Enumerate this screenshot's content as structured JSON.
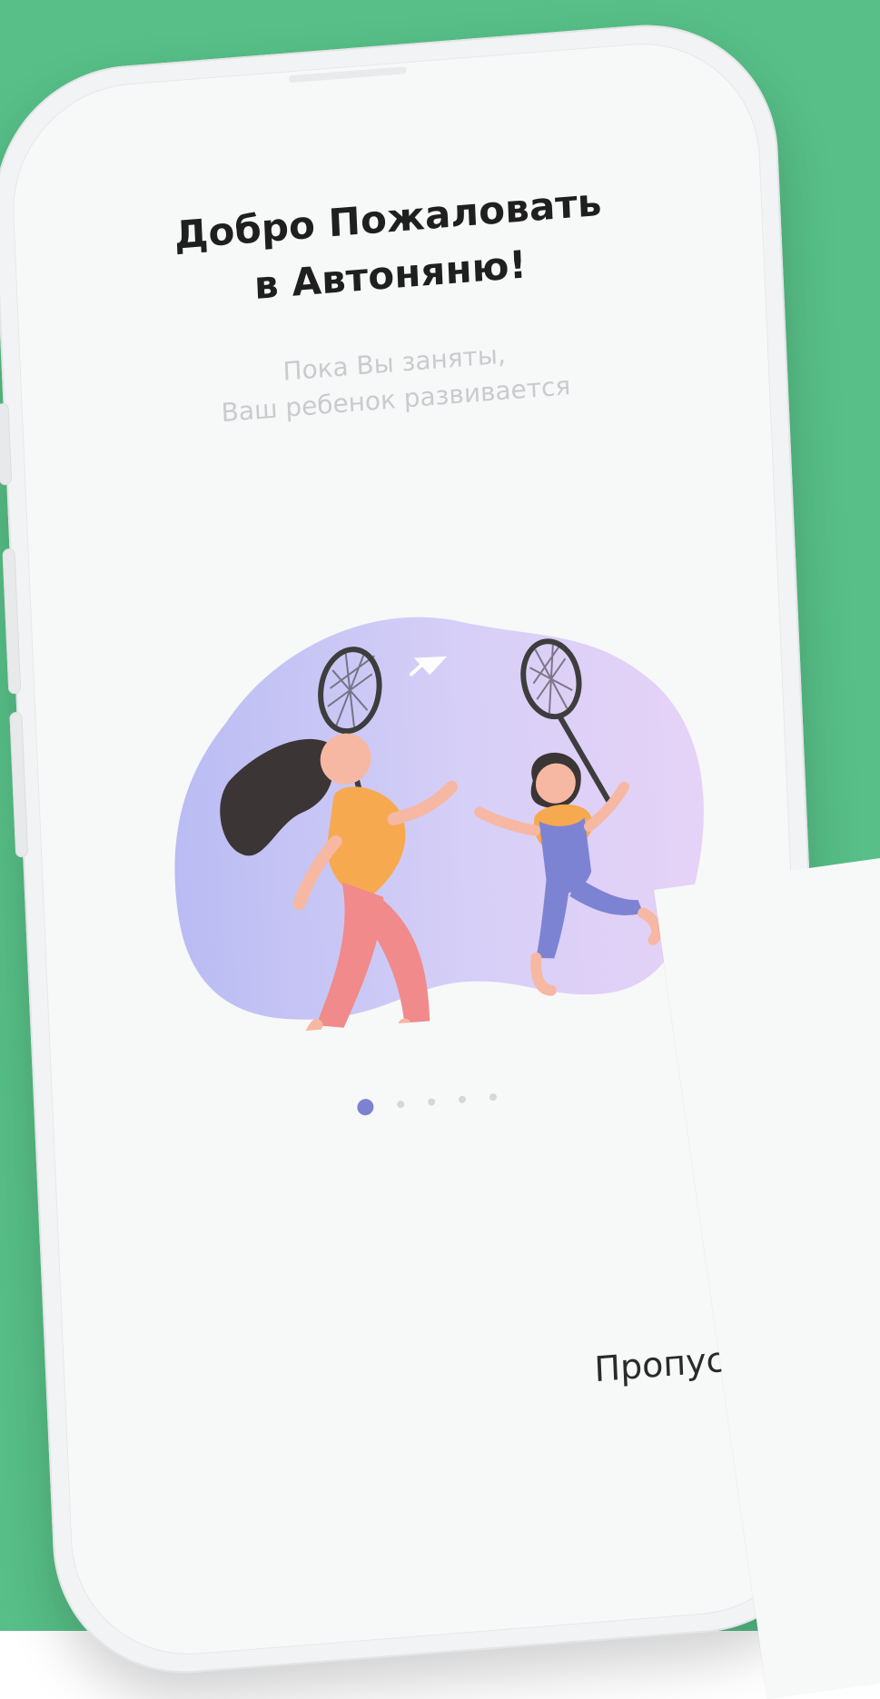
{
  "screen": {
    "title_line1": "Добро Пожаловать",
    "title_line2": "в Автоняню!",
    "subtitle_line1": "Пока Вы заняты,",
    "subtitle_line2": "Ваш ребенок развивается",
    "skip_label": "Пропустить"
  },
  "pagination": {
    "active_index": 0,
    "count": 5
  },
  "colors": {
    "background": "#57bf87",
    "dot_active": "#7c82d1",
    "dot_inactive": "#d5d7da",
    "text_primary": "#1f1f1f",
    "text_secondary": "#c9cbce"
  },
  "icons": {
    "illustration": "badminton-mother-daughter-illustration",
    "shuttlecock": "shuttlecock-icon"
  }
}
